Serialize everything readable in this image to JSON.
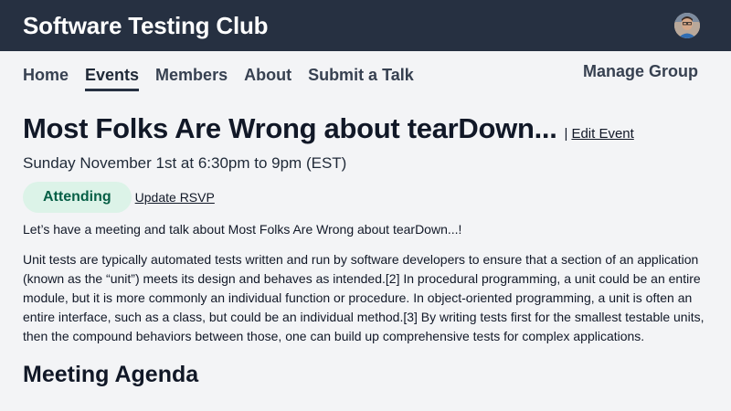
{
  "header": {
    "brand": "Software Testing Club",
    "avatar_icon": "user-avatar"
  },
  "nav": {
    "items": [
      {
        "label": "Home",
        "active": false
      },
      {
        "label": "Events",
        "active": true
      },
      {
        "label": "Members",
        "active": false
      },
      {
        "label": "About",
        "active": false
      },
      {
        "label": "Submit a Talk",
        "active": false
      }
    ],
    "manage_label": "Manage Group"
  },
  "event": {
    "title": "Most Folks Are Wrong about tearDown...",
    "separator": "|",
    "edit_label": "Edit Event",
    "datetime": "Sunday November 1st at 6:30pm to 9pm (EST)",
    "rsvp_status": "Attending",
    "update_rsvp_label": "Update RSVP",
    "intro": "Let’s have a meeting and talk about Most Folks Are Wrong about tearDown...!",
    "description": "Unit tests are typically automated tests written and run by software developers to ensure that a section of an application (known as the “unit”) meets its design and behaves as intended.[2] In procedural programming, a unit could be an entire module, but it is more commonly an individual function or procedure. In object-oriented programming, a unit is often an entire interface, such as a class, but could be an individual method.[3] By writing tests first for the smallest testable units, then the compound behaviors between those, one can build up comprehensive tests for complex applications.",
    "agenda_heading": "Meeting Agenda"
  },
  "colors": {
    "topbar": "#263041",
    "badge_bg": "#dcf3e8",
    "badge_text": "#065f46",
    "page_bg": "#f3f4f6"
  }
}
